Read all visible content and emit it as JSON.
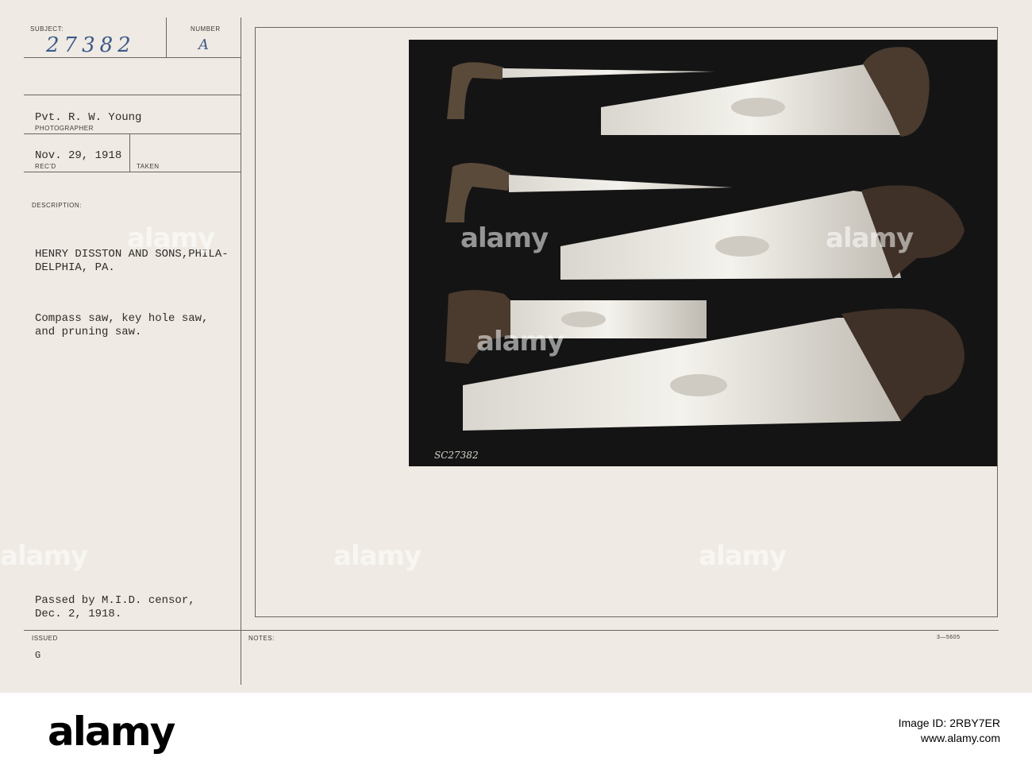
{
  "card": {
    "subject_label": "SUBJECT:",
    "number_label": "NUMBER",
    "subject_number": "27382",
    "number_value": "A",
    "photographer_name": "Pvt. R. W. Young",
    "photographer_label": "PHOTOGRAPHER",
    "date": "Nov. 29, 1918",
    "recd_label": "REC'D",
    "taken_label": "TAKEN",
    "description_label": "DESCRIPTION:",
    "description_line1": "HENRY DISSTON AND SONS,PHILA-",
    "description_line2": "DELPHIA, PA.",
    "caption_line1": "Compass saw, key hole saw,",
    "caption_line2": "and pruning saw.",
    "censor_line1": "Passed by M.I.D. censor,",
    "censor_line2": "Dec. 2, 1918.",
    "issued_label": "ISSUED",
    "issued_value": "G",
    "notes_label": "NOTES:",
    "form_code": "3—5605",
    "photo_neg_number": "SC27382"
  },
  "watermark": {
    "text": "alamy"
  },
  "footer": {
    "logo": "alamy",
    "image_id_line": "Image ID: 2RBY7ER",
    "url": "www.alamy.com"
  },
  "colors": {
    "card_bg": "#efeae3",
    "ink": "#2f2c2a",
    "photo_bg": "#141414",
    "hand_ink": "#3b5a8a"
  }
}
